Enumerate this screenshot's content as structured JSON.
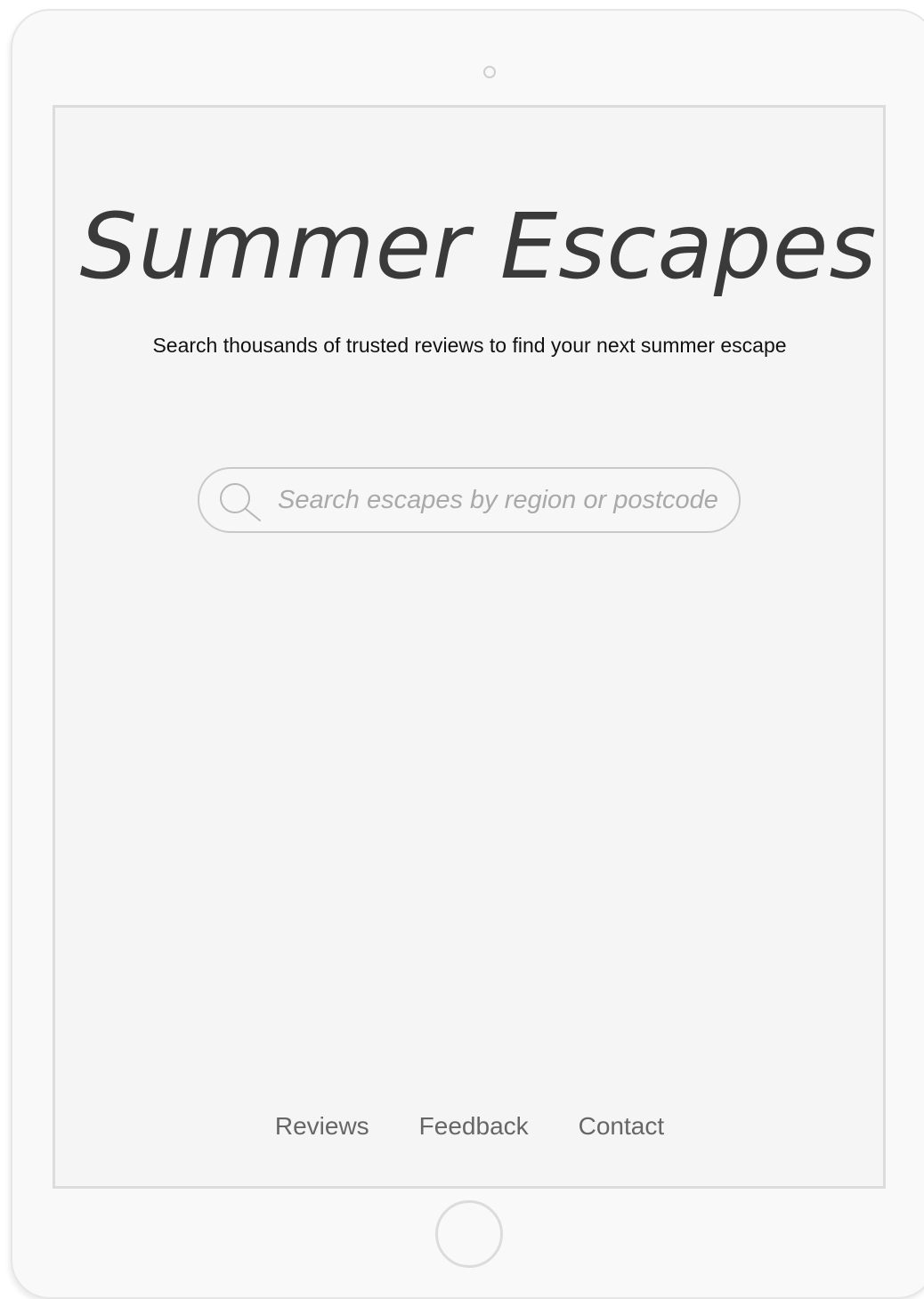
{
  "hero": {
    "title": "Summer Escapes",
    "subtitle": "Search thousands of trusted reviews to find your next summer escape"
  },
  "search": {
    "placeholder": "Search escapes by region or postcode",
    "value": "",
    "icon": "search-icon"
  },
  "footer_nav": {
    "items": [
      {
        "label": "Reviews"
      },
      {
        "label": "Feedback"
      },
      {
        "label": "Contact"
      }
    ]
  },
  "colors": {
    "screen_background": "#f5f5f5",
    "device_frame": "#f9f9f9",
    "title_text": "#3a3a3a",
    "nav_text": "#666666",
    "placeholder_text": "#a9a9a9"
  }
}
